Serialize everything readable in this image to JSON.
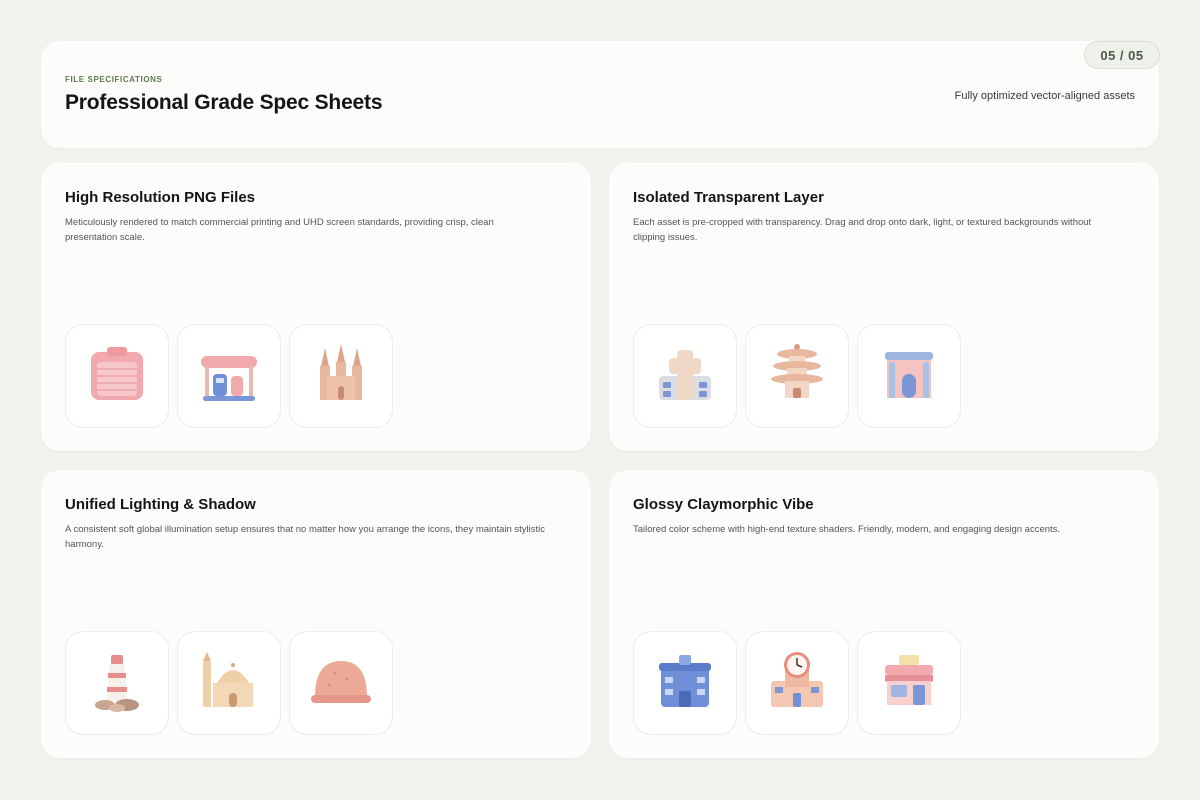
{
  "header": {
    "eyebrow": "FILE SPECIFICATIONS",
    "title": "Professional Grade Spec Sheets",
    "subtitle": "Fully optimized vector-aligned assets",
    "page_counter": "05 / 05"
  },
  "cards": [
    {
      "title": "High Resolution PNG Files",
      "description": "Meticulously rendered to match commercial printing and UHD screen standards, providing crisp, clean presentation scale.",
      "icons": [
        "garage-icon",
        "gas-station-icon",
        "cathedral-icon"
      ]
    },
    {
      "title": "Isolated Transparent Layer",
      "description": "Each asset is pre-cropped with transparency. Drag and drop onto dark, light, or textured backgrounds without clipping issues.",
      "icons": [
        "hospital-icon",
        "pagoda-icon",
        "museum-icon"
      ]
    },
    {
      "title": "Unified Lighting & Shadow",
      "description": "A consistent soft global illumination setup ensures that no matter how you arrange the icons, they maintain stylistic harmony.",
      "icons": [
        "lighthouse-icon",
        "mosque-icon",
        "dome-icon"
      ]
    },
    {
      "title": "Glossy Claymorphic Vibe",
      "description": "Tailored color scheme with high-end texture shaders. Friendly, modern, and engaging design accents.",
      "icons": [
        "police-station-icon",
        "clock-tower-icon",
        "shop-icon"
      ]
    }
  ],
  "colors": {
    "background": "#f4f2ee",
    "card": "#fdfcfb",
    "eyebrow": "#5f7a4e",
    "pink": "#f2a9ad",
    "blue": "#6f8fd8",
    "peach": "#e8b89e"
  }
}
